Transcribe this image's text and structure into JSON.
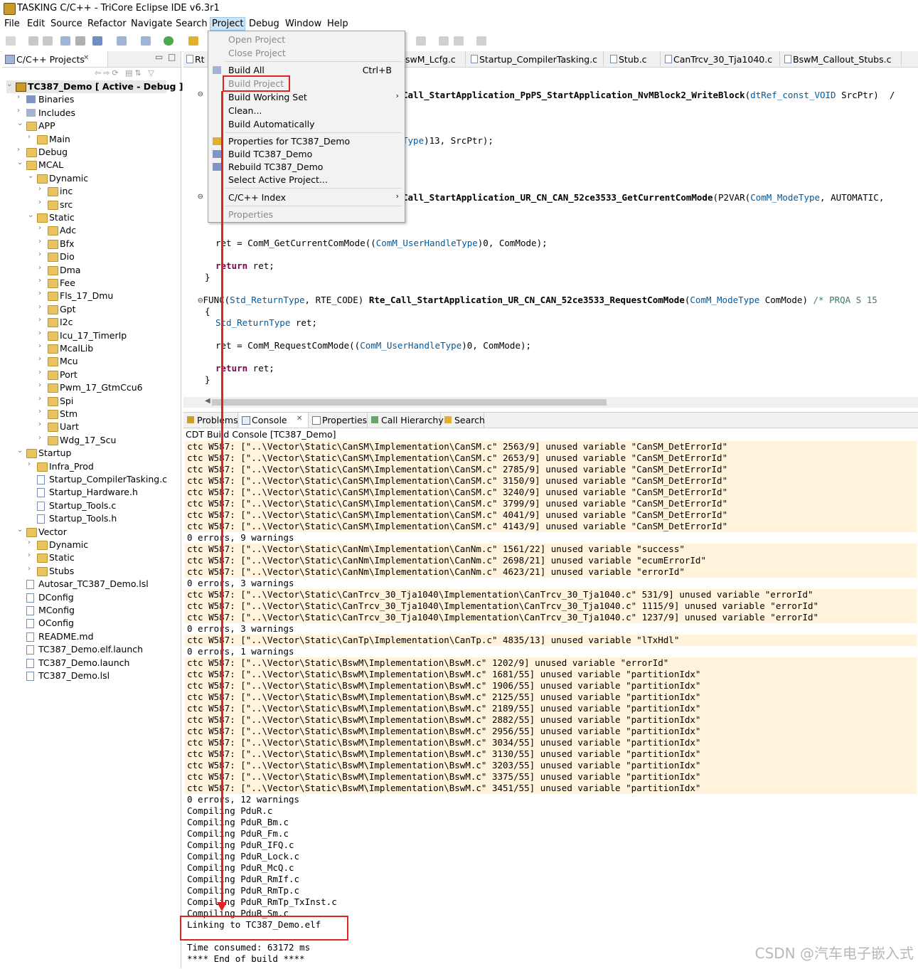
{
  "window": {
    "title": "TASKING C/C++ - TriCore Eclipse IDE v6.3r1"
  },
  "menubar": [
    "File",
    "Edit",
    "Source",
    "Refactor",
    "Navigate",
    "Search",
    "Project",
    "Debug",
    "Window",
    "Help"
  ],
  "project_menu": {
    "items": [
      {
        "label": "Open Project",
        "shortcut": "",
        "enabled": false
      },
      {
        "label": "Close Project",
        "shortcut": "",
        "enabled": false
      },
      {
        "label": "Build All",
        "shortcut": "Ctrl+B",
        "enabled": true
      },
      {
        "label": "Build Project",
        "shortcut": "",
        "enabled": false
      },
      {
        "label": "Build Working Set",
        "shortcut": "",
        "enabled": true
      },
      {
        "label": "Clean...",
        "shortcut": "",
        "enabled": true
      },
      {
        "label": "Build Automatically",
        "shortcut": "",
        "enabled": true
      },
      {
        "label": "Properties for TC387_Demo",
        "shortcut": "",
        "enabled": true
      },
      {
        "label": "Build TC387_Demo",
        "shortcut": "",
        "enabled": true
      },
      {
        "label": "Rebuild TC387_Demo",
        "shortcut": "",
        "enabled": true
      },
      {
        "label": "Select Active Project...",
        "shortcut": "",
        "enabled": true
      },
      {
        "label": "C/C++ Index",
        "shortcut": "",
        "enabled": true
      },
      {
        "label": "Properties",
        "shortcut": "",
        "enabled": false
      }
    ]
  },
  "left_panel": {
    "tab_label": "C/C++ Projects",
    "tree": [
      {
        "label": "TC387_Demo [ Active - Debug ]"
      },
      {
        "label": "Binaries"
      },
      {
        "label": "Includes"
      },
      {
        "label": "APP"
      },
      {
        "label": "Main"
      },
      {
        "label": "Debug"
      },
      {
        "label": "MCAL"
      },
      {
        "label": "Dynamic"
      },
      {
        "label": "inc"
      },
      {
        "label": "src"
      },
      {
        "label": "Static"
      },
      {
        "label": "Adc"
      },
      {
        "label": "Bfx"
      },
      {
        "label": "Dio"
      },
      {
        "label": "Dma"
      },
      {
        "label": "Fee"
      },
      {
        "label": "Fls_17_Dmu"
      },
      {
        "label": "Gpt"
      },
      {
        "label": "I2c"
      },
      {
        "label": "Icu_17_TimerIp"
      },
      {
        "label": "McalLib"
      },
      {
        "label": "Mcu"
      },
      {
        "label": "Port"
      },
      {
        "label": "Pwm_17_GtmCcu6"
      },
      {
        "label": "Spi"
      },
      {
        "label": "Stm"
      },
      {
        "label": "Uart"
      },
      {
        "label": "Wdg_17_Scu"
      },
      {
        "label": "Startup"
      },
      {
        "label": "Infra_Prod"
      },
      {
        "label": "Startup_CompilerTasking.c"
      },
      {
        "label": "Startup_Hardware.h"
      },
      {
        "label": "Startup_Tools.c"
      },
      {
        "label": "Startup_Tools.h"
      },
      {
        "label": "Vector"
      },
      {
        "label": "Dynamic"
      },
      {
        "label": "Static"
      },
      {
        "label": "Stubs"
      },
      {
        "label": "Autosar_TC387_Demo.lsl"
      },
      {
        "label": "DConfig"
      },
      {
        "label": "MConfig"
      },
      {
        "label": "OConfig"
      },
      {
        "label": "README.md"
      },
      {
        "label": "TC387_Demo.elf.launch"
      },
      {
        "label": "TC387_Demo.launch"
      },
      {
        "label": "TC387_Demo.lsl"
      }
    ]
  },
  "editor": {
    "tabs": [
      "Rt",
      "swM_Lcfg.c",
      "Startup_CompilerTasking.c",
      "Stub.c",
      "CanTrcv_30_Tja1040.c",
      "BswM_Callout_Stubs.c"
    ],
    "code": {
      "l1_fn": "Call_StartApplication_PpPS_StartApplication_NvMBlock2_WriteBlock",
      "l1_open": "(",
      "l1_type": "dtRef_const_VOID",
      "l1_rest": " SrcPtr)  /",
      "l2_type": "Type",
      "l2_rest": ")13, SrcPtr);",
      "l3_fn": "Call_StartApplication_UR_CN_CAN_52ce3533_GetCurrentComMode",
      "l3_a": "(P2VAR(",
      "l3_type": "ComM_ModeType",
      "l3_b": ", AUTOMATIC,",
      "l4_a": "ret = ComM_GetCurrentComMode((",
      "l4_type": "ComM_UserHandleType",
      "l4_b": ")0, ComMode);",
      "kw_return": "return",
      "ret_rest": " ret;",
      "close_brace": "}",
      "open_brace": "{",
      "l5_a": "FUNC(",
      "l5_type": "Std_ReturnType",
      "l5_b": ", RTE_CODE) ",
      "l5_fn": "Rte_Call_StartApplication_UR_CN_CAN_52ce3533_RequestComMode",
      "l5_c": "(",
      "l5_type2": "ComM_ModeType",
      "l5_d": " ComMode) ",
      "l5_cm": "/* PRQA S 15",
      "l6_type": "Std_ReturnType",
      "l6_rest": " ret;",
      "l7_a": "ret = ComM_RequestComMode((",
      "l7_type": "ComM_UserHandleType",
      "l7_b": ")0, ComMode);"
    }
  },
  "bottom_panel": {
    "tabs": [
      "Problems",
      "Console",
      "Properties",
      "Call Hierarchy",
      "Search"
    ],
    "console_title": "CDT Build Console [TC387_Demo]",
    "lines": [
      {
        "t": "ctc W587: [\"..\\Vector\\Static\\CanSM\\Implementation\\CanSM.c\" 2563/9] unused variable \"CanSM_DetErrorId\"",
        "w": true
      },
      {
        "t": "ctc W587: [\"..\\Vector\\Static\\CanSM\\Implementation\\CanSM.c\" 2653/9] unused variable \"CanSM_DetErrorId\"",
        "w": true
      },
      {
        "t": "ctc W587: [\"..\\Vector\\Static\\CanSM\\Implementation\\CanSM.c\" 2785/9] unused variable \"CanSM_DetErrorId\"",
        "w": true
      },
      {
        "t": "ctc W587: [\"..\\Vector\\Static\\CanSM\\Implementation\\CanSM.c\" 3150/9] unused variable \"CanSM_DetErrorId\"",
        "w": true
      },
      {
        "t": "ctc W587: [\"..\\Vector\\Static\\CanSM\\Implementation\\CanSM.c\" 3240/9] unused variable \"CanSM_DetErrorId\"",
        "w": true
      },
      {
        "t": "ctc W587: [\"..\\Vector\\Static\\CanSM\\Implementation\\CanSM.c\" 3799/9] unused variable \"CanSM_DetErrorId\"",
        "w": true
      },
      {
        "t": "ctc W587: [\"..\\Vector\\Static\\CanSM\\Implementation\\CanSM.c\" 4041/9] unused variable \"CanSM_DetErrorId\"",
        "w": true
      },
      {
        "t": "ctc W587: [\"..\\Vector\\Static\\CanSM\\Implementation\\CanSM.c\" 4143/9] unused variable \"CanSM_DetErrorId\"",
        "w": true
      },
      {
        "t": "0 errors, 9 warnings",
        "w": false
      },
      {
        "t": "ctc W587: [\"..\\Vector\\Static\\CanNm\\Implementation\\CanNm.c\" 1561/22] unused variable \"success\"",
        "w": true
      },
      {
        "t": "ctc W587: [\"..\\Vector\\Static\\CanNm\\Implementation\\CanNm.c\" 2698/21] unused variable \"ecumErrorId\"",
        "w": true
      },
      {
        "t": "ctc W587: [\"..\\Vector\\Static\\CanNm\\Implementation\\CanNm.c\" 4623/21] unused variable \"errorId\"",
        "w": true
      },
      {
        "t": "0 errors, 3 warnings",
        "w": false
      },
      {
        "t": "ctc W587: [\"..\\Vector\\Static\\CanTrcv_30_Tja1040\\Implementation\\CanTrcv_30_Tja1040.c\" 531/9] unused variable \"errorId\"",
        "w": true
      },
      {
        "t": "ctc W587: [\"..\\Vector\\Static\\CanTrcv_30_Tja1040\\Implementation\\CanTrcv_30_Tja1040.c\" 1115/9] unused variable \"errorId\"",
        "w": true
      },
      {
        "t": "ctc W587: [\"..\\Vector\\Static\\CanTrcv_30_Tja1040\\Implementation\\CanTrcv_30_Tja1040.c\" 1237/9] unused variable \"errorId\"",
        "w": true
      },
      {
        "t": "0 errors, 3 warnings",
        "w": false
      },
      {
        "t": "ctc W587: [\"..\\Vector\\Static\\CanTp\\Implementation\\CanTp.c\" 4835/13] unused variable \"lTxHdl\"",
        "w": true
      },
      {
        "t": "0 errors, 1 warnings",
        "w": false
      },
      {
        "t": "ctc W587: [\"..\\Vector\\Static\\BswM\\Implementation\\BswM.c\" 1202/9] unused variable \"errorId\"",
        "w": true
      },
      {
        "t": "ctc W587: [\"..\\Vector\\Static\\BswM\\Implementation\\BswM.c\" 1681/55] unused variable \"partitionIdx\"",
        "w": true
      },
      {
        "t": "ctc W587: [\"..\\Vector\\Static\\BswM\\Implementation\\BswM.c\" 1906/55] unused variable \"partitionIdx\"",
        "w": true
      },
      {
        "t": "ctc W587: [\"..\\Vector\\Static\\BswM\\Implementation\\BswM.c\" 2125/55] unused variable \"partitionIdx\"",
        "w": true
      },
      {
        "t": "ctc W587: [\"..\\Vector\\Static\\BswM\\Implementation\\BswM.c\" 2189/55] unused variable \"partitionIdx\"",
        "w": true
      },
      {
        "t": "ctc W587: [\"..\\Vector\\Static\\BswM\\Implementation\\BswM.c\" 2882/55] unused variable \"partitionIdx\"",
        "w": true
      },
      {
        "t": "ctc W587: [\"..\\Vector\\Static\\BswM\\Implementation\\BswM.c\" 2956/55] unused variable \"partitionIdx\"",
        "w": true
      },
      {
        "t": "ctc W587: [\"..\\Vector\\Static\\BswM\\Implementation\\BswM.c\" 3034/55] unused variable \"partitionIdx\"",
        "w": true
      },
      {
        "t": "ctc W587: [\"..\\Vector\\Static\\BswM\\Implementation\\BswM.c\" 3130/55] unused variable \"partitionIdx\"",
        "w": true
      },
      {
        "t": "ctc W587: [\"..\\Vector\\Static\\BswM\\Implementation\\BswM.c\" 3203/55] unused variable \"partitionIdx\"",
        "w": true
      },
      {
        "t": "ctc W587: [\"..\\Vector\\Static\\BswM\\Implementation\\BswM.c\" 3375/55] unused variable \"partitionIdx\"",
        "w": true
      },
      {
        "t": "ctc W587: [\"..\\Vector\\Static\\BswM\\Implementation\\BswM.c\" 3451/55] unused variable \"partitionIdx\"",
        "w": true
      },
      {
        "t": "0 errors, 12 warnings",
        "w": false
      },
      {
        "t": "Compiling PduR.c",
        "w": false
      },
      {
        "t": "Compiling PduR_Bm.c",
        "w": false
      },
      {
        "t": "Compiling PduR_Fm.c",
        "w": false
      },
      {
        "t": "Compiling PduR_IFQ.c",
        "w": false
      },
      {
        "t": "Compiling PduR_Lock.c",
        "w": false
      },
      {
        "t": "Compiling PduR_McQ.c",
        "w": false
      },
      {
        "t": "Compiling PduR_RmIf.c",
        "w": false
      },
      {
        "t": "Compiling PduR_RmTp.c",
        "w": false
      },
      {
        "t": "Compiling PduR_RmTp_TxInst.c",
        "w": false
      },
      {
        "t": "Compiling PduR_Sm.c",
        "w": false
      },
      {
        "t": "Linking to TC387_Demo.elf",
        "w": false
      },
      {
        "t": "",
        "w": false
      },
      {
        "t": "Time consumed: 63172 ms",
        "w": false
      },
      {
        "t": "**** End of build ****",
        "w": false
      }
    ]
  },
  "watermark": "CSDN @汽车电子嵌入式",
  "colors": {
    "highlight": "#e32222",
    "warning_bg": "#fff3dc",
    "menu_selected": "#cce4f7"
  }
}
